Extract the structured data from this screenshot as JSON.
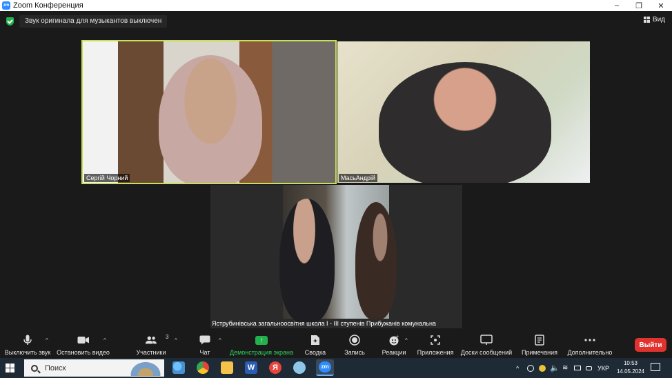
{
  "window": {
    "title": "Zoom Конференция"
  },
  "notice": {
    "text": "Звук оригинала для музыкантов выключен"
  },
  "view": {
    "label": "Вид"
  },
  "participants": [
    {
      "name": "Сергій Чорний"
    },
    {
      "name": "МасьАндрій"
    }
  ],
  "room_caption": "Яструбинівська загальноосвітня школа І - ІІІ ступенів Прибужанів комунальна",
  "toolbar": {
    "mute_label": "Выключить звук",
    "video_label": "Остановить видео",
    "participants_label": "Участники",
    "participants_count": "3",
    "chat_label": "Чат",
    "share_label": "Демонстрация экрана",
    "summary_label": "Сводка",
    "record_label": "Запись",
    "reactions_label": "Реакции",
    "apps_label": "Приложения",
    "whiteboards_label": "Доски сообщений",
    "notes_label": "Примечания",
    "more_label": "Дополнительно",
    "leave_label": "Выйти"
  },
  "taskbar": {
    "search_label": "Поиск",
    "language": "УКР",
    "time": "10:53",
    "date": "14.05.2024"
  },
  "colors": {
    "active_speaker": "#c8e05a",
    "leave": "#e0322f",
    "share": "#23b14d"
  }
}
